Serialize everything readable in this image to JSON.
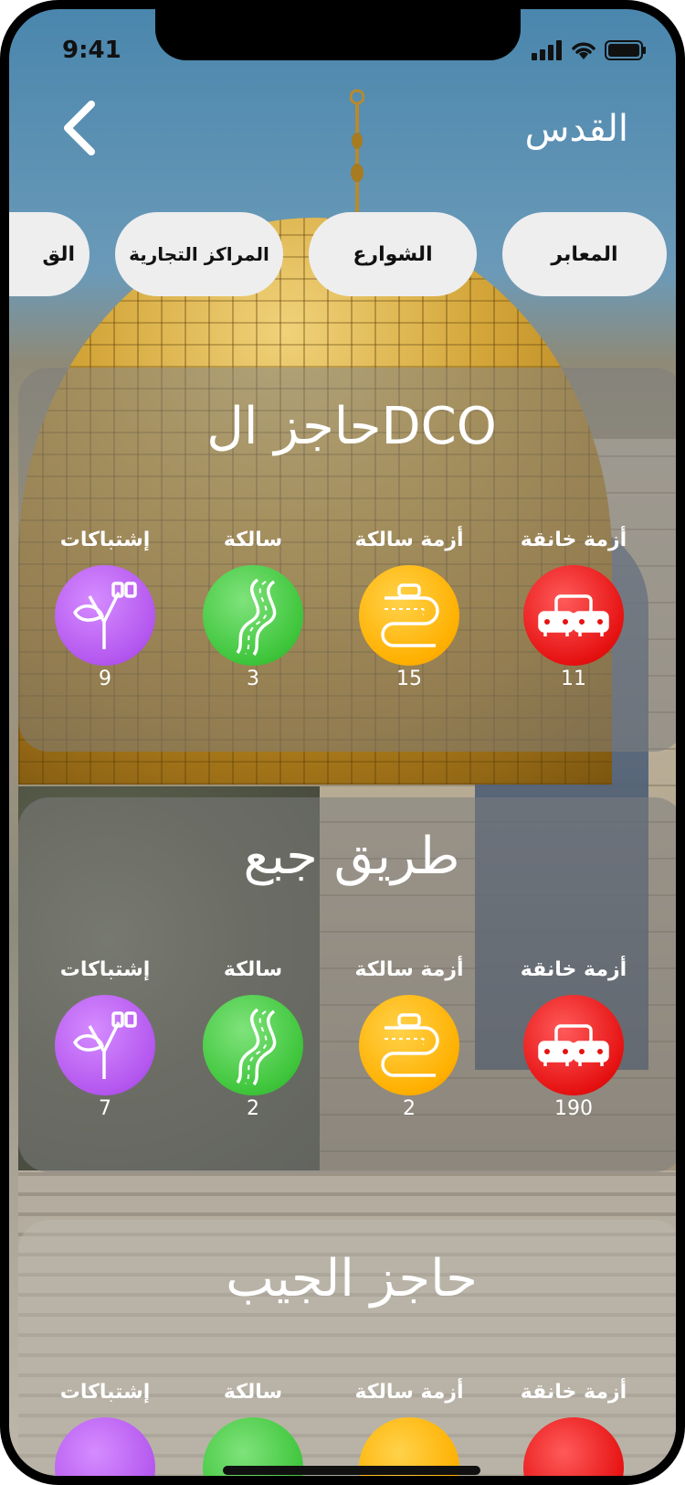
{
  "status_bar": {
    "time": "9:41"
  },
  "header": {
    "title": "القدس",
    "back_icon": "chevron-left-icon"
  },
  "categories": [
    {
      "label": "المعابر"
    },
    {
      "label": "الشوارع"
    },
    {
      "label": "المراكز التجارية"
    },
    {
      "label": "الق"
    }
  ],
  "stat_labels": {
    "severe": "أزمة خانقة",
    "moderate": "أزمة سالكة",
    "clear": "سالكة",
    "clashes": "إشتباكات"
  },
  "locations": [
    {
      "name": "حاجز الDCO",
      "severe": "11",
      "moderate": "15",
      "clear": "3",
      "clashes": "9"
    },
    {
      "name": "طريق جبع",
      "severe": "190",
      "moderate": "2",
      "clear": "2",
      "clashes": "7"
    },
    {
      "name": "حاجز الجيب"
    }
  ],
  "colors": {
    "severe": "#e61212",
    "moderate": "#ffb000",
    "clear": "#3ec53b",
    "clashes": "#b457ef",
    "chip_bg": "#eeeeee"
  }
}
